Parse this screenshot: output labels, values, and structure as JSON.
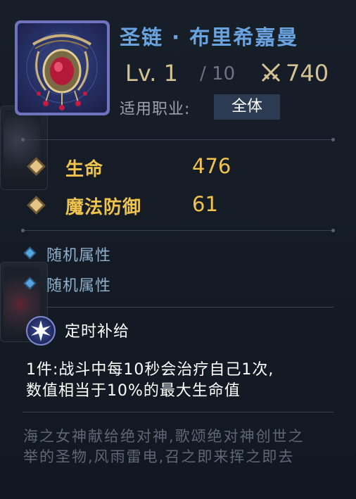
{
  "item": {
    "name": "圣链 · 布里希嘉曼",
    "level": "Lv. 1",
    "max_level": "/ 10",
    "power": "740",
    "class_label": "适用职业:",
    "class_value": "全体",
    "icon": "necklace-pendant-icon"
  },
  "main_stats": [
    {
      "name": "生命",
      "value": "476"
    },
    {
      "name": "魔法防御",
      "value": "61"
    }
  ],
  "random_attrs": [
    "随机属性",
    "随机属性"
  ],
  "set_bonus": {
    "title": "定时补给",
    "desc_line1": "1件:战斗中每10秒会治疗自己1次,",
    "desc_line2": "数值相当于10%的最大生命值"
  },
  "flavor": {
    "line1": "海之女神献给绝对神,歌颂绝对神创世之",
    "line2": "举的圣物,风雨雷电,召之即来挥之即去"
  },
  "colors": {
    "title": "#6aa4e0",
    "stat": "#f0c44c",
    "level": "#d4c294",
    "badge_bg": "#2c3a52",
    "random_attr": "#8fb0cc"
  }
}
